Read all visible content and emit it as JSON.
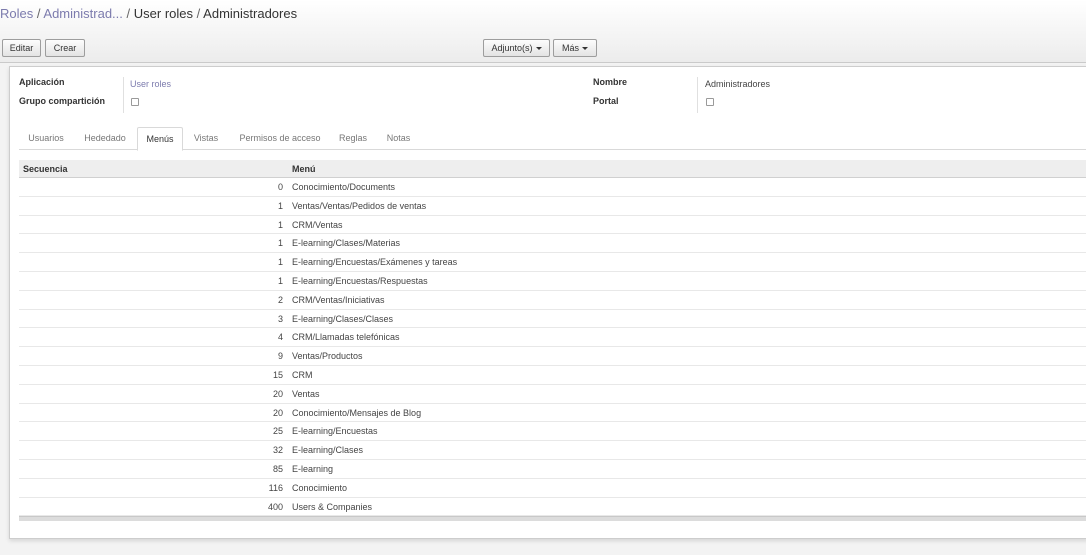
{
  "breadcrumb": {
    "items": [
      "Roles",
      "Administrad..."
    ],
    "separator": "/",
    "current": [
      "User roles",
      "Administradores"
    ]
  },
  "buttons": {
    "edit": "Editar",
    "create": "Crear",
    "attachments": "Adjunto(s)",
    "more": "Más"
  },
  "form": {
    "application_label": "Aplicación",
    "application_value": "User roles",
    "share_group_label": "Grupo compartición",
    "share_group_checked": false,
    "name_label": "Nombre",
    "name_value": "Administradores",
    "portal_label": "Portal",
    "portal_checked": false
  },
  "tabs": [
    "Usuarios",
    "Hededado",
    "Menús",
    "Vistas",
    "Permisos de acceso",
    "Reglas",
    "Notas"
  ],
  "active_tab": "Menús",
  "table": {
    "headers": {
      "sequence": "Secuencia",
      "menu": "Menú"
    },
    "rows": [
      {
        "sequence": "0",
        "menu": "Conocimiento/Documents"
      },
      {
        "sequence": "1",
        "menu": "Ventas/Ventas/Pedidos de ventas"
      },
      {
        "sequence": "1",
        "menu": "CRM/Ventas"
      },
      {
        "sequence": "1",
        "menu": "E-learning/Clases/Materias"
      },
      {
        "sequence": "1",
        "menu": "E-learning/Encuestas/Exámenes y tareas"
      },
      {
        "sequence": "1",
        "menu": "E-learning/Encuestas/Respuestas"
      },
      {
        "sequence": "2",
        "menu": "CRM/Ventas/Iniciativas"
      },
      {
        "sequence": "3",
        "menu": "E-learning/Clases/Clases"
      },
      {
        "sequence": "4",
        "menu": "CRM/Llamadas telefónicas"
      },
      {
        "sequence": "9",
        "menu": "Ventas/Productos"
      },
      {
        "sequence": "15",
        "menu": "CRM"
      },
      {
        "sequence": "20",
        "menu": "Ventas"
      },
      {
        "sequence": "20",
        "menu": "Conocimiento/Mensajes de Blog"
      },
      {
        "sequence": "25",
        "menu": "E-learning/Encuestas"
      },
      {
        "sequence": "32",
        "menu": "E-learning/Clases"
      },
      {
        "sequence": "85",
        "menu": "E-learning"
      },
      {
        "sequence": "116",
        "menu": "Conocimiento"
      },
      {
        "sequence": "400",
        "menu": "Users & Companies"
      }
    ]
  }
}
